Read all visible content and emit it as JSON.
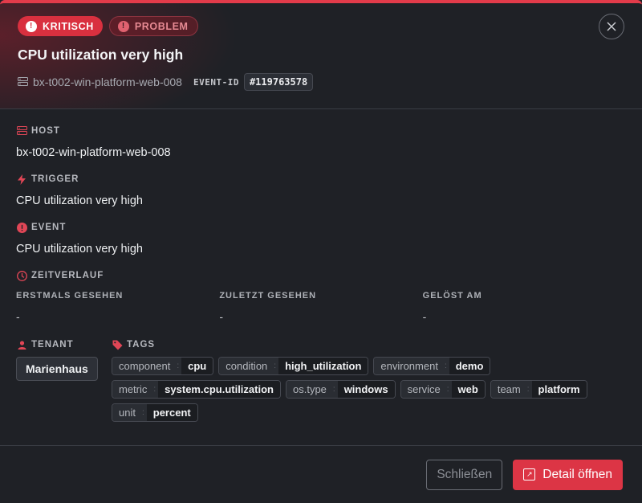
{
  "badges": {
    "severity": "KRITISCH",
    "status": "PROBLEM"
  },
  "header": {
    "title": "CPU utilization very high",
    "host": "bx-t002-win-platform-web-008",
    "event_id_label": "EVENT-ID",
    "event_id": "#119763578"
  },
  "sections": {
    "host": {
      "label": "HOST",
      "value": "bx-t002-win-platform-web-008"
    },
    "trigger": {
      "label": "TRIGGER",
      "value": "CPU utilization very high"
    },
    "event": {
      "label": "EVENT",
      "value": "CPU utilization very high"
    },
    "timeline": {
      "label": "ZEITVERLAUF",
      "first_seen_label": "ERSTMALS GESEHEN",
      "first_seen": "-",
      "last_seen_label": "ZULETZT GESEHEN",
      "last_seen": "-",
      "resolved_label": "GELÖST AM",
      "resolved": "-"
    },
    "tenant": {
      "label": "TENANT",
      "value": "Marienhaus"
    },
    "tags": {
      "label": "TAGS",
      "items": [
        {
          "key": "component",
          "value": "cpu"
        },
        {
          "key": "condition",
          "value": "high_utilization"
        },
        {
          "key": "environment",
          "value": "demo"
        },
        {
          "key": "metric",
          "value": "system.cpu.utilization"
        },
        {
          "key": "os.type",
          "value": "windows"
        },
        {
          "key": "service",
          "value": "web"
        },
        {
          "key": "team",
          "value": "platform"
        },
        {
          "key": "unit",
          "value": "percent"
        }
      ]
    }
  },
  "footer": {
    "close_label": "Schließen",
    "detail_label": "Detail öffnen"
  },
  "colors": {
    "accent": "#dc3545",
    "background": "#1f2126"
  }
}
